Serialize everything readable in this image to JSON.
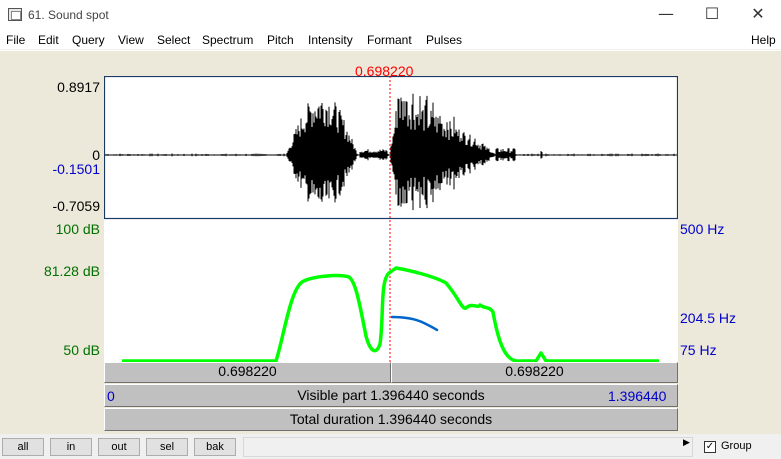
{
  "window": {
    "title": "61. Sound spot",
    "minimize": "—",
    "maximize": "☐",
    "close": "✕"
  },
  "menu": [
    "File",
    "Edit",
    "Query",
    "View",
    "Select",
    "Spectrum",
    "Pitch",
    "Intensity",
    "Formant",
    "Pulses",
    "Help"
  ],
  "cursor": {
    "time_label": "0.698220",
    "color": "#ff0000"
  },
  "waveform": {
    "y_max_label": "0.8917",
    "zero_label": "0",
    "cursor_value_label": "-0.1501",
    "y_min_label": "-0.7059"
  },
  "analysis": {
    "intensity_top_label": "100 dB",
    "intensity_value_label": "81.28 dB",
    "intensity_bottom_label": "50 dB",
    "pitch_top_label": "500 Hz",
    "pitch_value_label": "204.5 Hz",
    "pitch_bottom_label": "75 Hz",
    "intensity_color": "#00ff00",
    "pitch_color": "#0066cc"
  },
  "timebar": {
    "left_segment": "0.698220",
    "right_segment": "0.698220",
    "visible_start": "0",
    "visible_text": "Visible part 1.396440 seconds",
    "visible_end": "1.396440",
    "total_text": "Total duration 1.396440 seconds"
  },
  "buttons": {
    "all": "all",
    "in": "in",
    "out": "out",
    "sel": "sel",
    "bak": "bak",
    "group_label": "Group",
    "group_checked": true
  }
}
